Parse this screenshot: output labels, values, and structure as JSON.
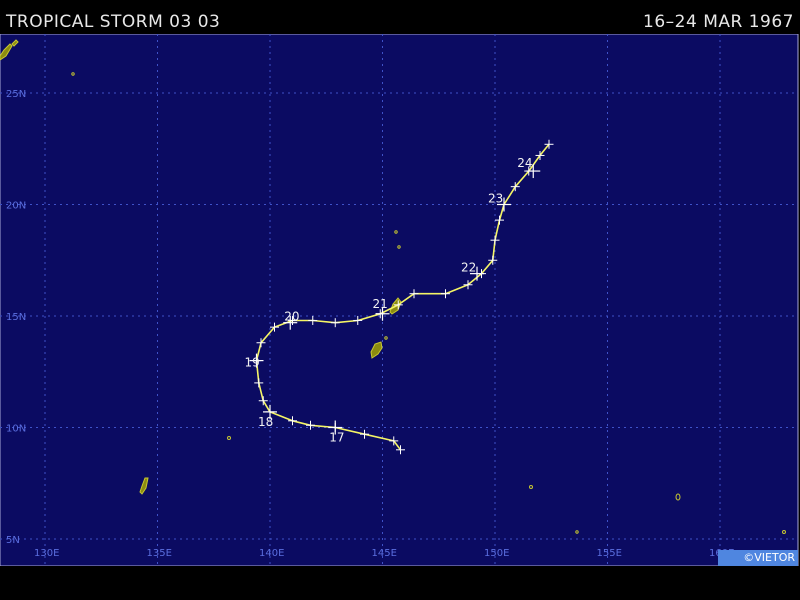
{
  "header": {
    "title": "TROPICAL STORM 03 03",
    "dates": "16–24 MAR 1967"
  },
  "credit": "©VIETOR",
  "colors": {
    "ocean": "#0b0b62",
    "grid": "#3f52c8",
    "track": "#f5f565",
    "land": "#8c8c10"
  },
  "map": {
    "lon_labels": [
      "130E",
      "135E",
      "140E",
      "145E",
      "150E",
      "155E",
      "160E"
    ],
    "lat_labels": [
      "5N",
      "10N",
      "15N",
      "20N",
      "25N"
    ]
  },
  "chart_data": {
    "type": "scatter",
    "series": [
      {
        "points": [
          {
            "lon": 145.8,
            "lat": 9.0
          },
          {
            "lon": 145.5,
            "lat": 9.4
          },
          {
            "lon": 144.2,
            "lat": 9.7
          },
          {
            "lon": 142.9,
            "lat": 10.0
          },
          {
            "lon": 141.8,
            "lat": 10.1
          },
          {
            "lon": 141.0,
            "lat": 10.3
          },
          {
            "lon": 140.0,
            "lat": 10.7
          },
          {
            "lon": 139.7,
            "lat": 11.2
          },
          {
            "lon": 139.5,
            "lat": 12.0
          },
          {
            "lon": 139.4,
            "lat": 13.0
          },
          {
            "lon": 139.6,
            "lat": 13.8
          },
          {
            "lon": 140.2,
            "lat": 14.5
          },
          {
            "lon": 141.0,
            "lat": 14.8
          },
          {
            "lon": 141.9,
            "lat": 14.8
          },
          {
            "lon": 142.9,
            "lat": 14.7
          },
          {
            "lon": 143.9,
            "lat": 14.8
          },
          {
            "lon": 144.9,
            "lat": 15.1
          },
          {
            "lon": 145.7,
            "lat": 15.5
          },
          {
            "lon": 146.4,
            "lat": 16.0
          },
          {
            "lon": 147.8,
            "lat": 16.0
          },
          {
            "lon": 148.8,
            "lat": 16.4
          },
          {
            "lon": 149.4,
            "lat": 16.9
          },
          {
            "lon": 149.9,
            "lat": 17.5
          },
          {
            "lon": 150.0,
            "lat": 18.4
          },
          {
            "lon": 150.2,
            "lat": 19.3
          },
          {
            "lon": 150.4,
            "lat": 20.0
          },
          {
            "lon": 150.9,
            "lat": 20.8
          },
          {
            "lon": 151.5,
            "lat": 21.5
          },
          {
            "lon": 152.0,
            "lat": 22.2
          },
          {
            "lon": 152.4,
            "lat": 22.7
          }
        ],
        "day_labels": [
          {
            "text": "17",
            "lon": 142.9,
            "lat": 10.0
          },
          {
            "text": "18",
            "lon": 140.0,
            "lat": 10.7
          },
          {
            "text": "19",
            "lon": 139.4,
            "lat": 13.0
          },
          {
            "text": "20",
            "lon": 140.9,
            "lat": 14.7
          },
          {
            "text": "21",
            "lon": 145.0,
            "lat": 15.1
          },
          {
            "text": "22",
            "lon": 149.2,
            "lat": 16.9
          },
          {
            "text": "23",
            "lon": 150.4,
            "lat": 20.0
          },
          {
            "text": "24",
            "lon": 151.7,
            "lat": 21.5
          }
        ]
      }
    ]
  }
}
